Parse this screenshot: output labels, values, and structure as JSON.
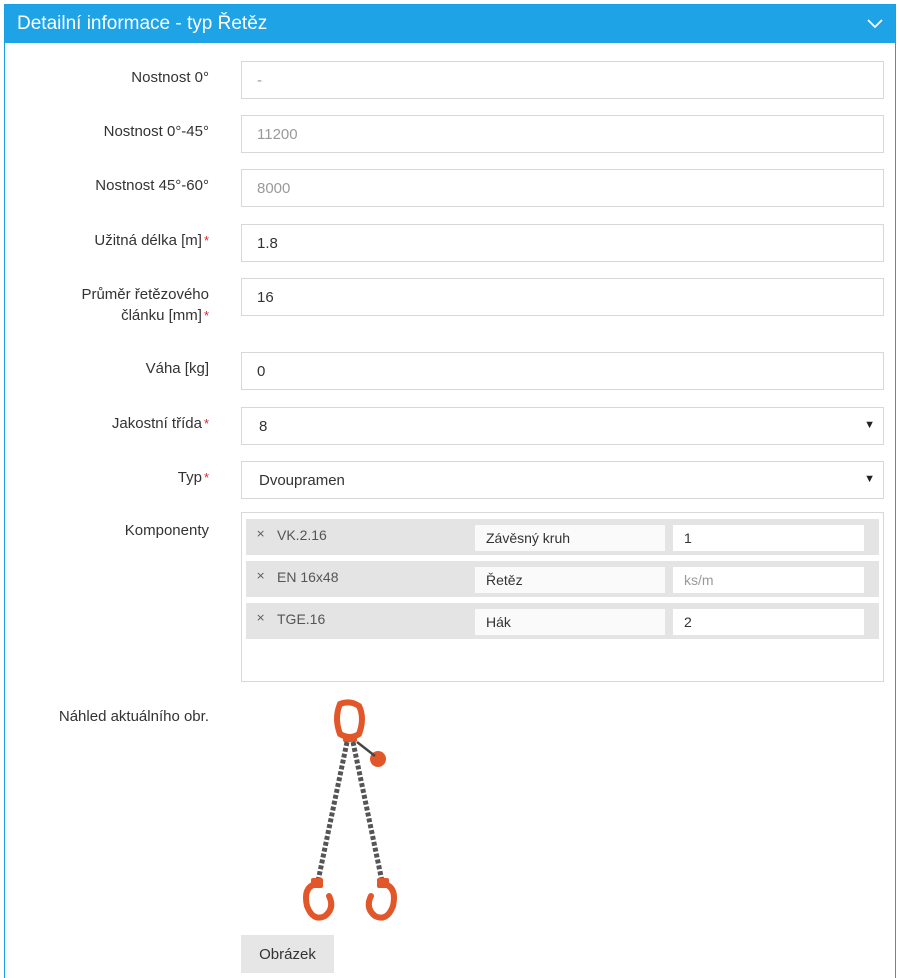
{
  "header": {
    "title": "Detailní informace - typ Řetěz"
  },
  "icons": {
    "collapse": "chevron-down-icon",
    "remove": "close-icon",
    "select": "caret-down-icon"
  },
  "colors": {
    "accent": "#1ea3e6",
    "required": "#d9262b"
  },
  "form": {
    "nostnost0": {
      "label": "Nostnost 0°",
      "value": "-"
    },
    "nostnost045": {
      "label": "Nostnost 0°-45°",
      "value": "11200"
    },
    "nostnost4560": {
      "label": "Nostnost 45°-60°",
      "value": "8000"
    },
    "uzitna_delka": {
      "label": "Užitná délka [m]",
      "value": "1.8",
      "required": "*"
    },
    "prumer": {
      "label_line1": "Průměr řetězového",
      "label_line2": "článku [mm]",
      "value": "16",
      "required": "*"
    },
    "vaha": {
      "label": "Váha [kg]",
      "value": "0"
    },
    "jakostni_trida": {
      "label": "Jakostní třída",
      "value": "8",
      "required": "*"
    },
    "typ": {
      "label": "Typ",
      "value": "Dvoupramen",
      "required": "*"
    }
  },
  "komponenty": {
    "label": "Komponenty",
    "items": [
      {
        "remove": "×",
        "code": "VK.2.16",
        "name": "Závěsný kruh",
        "qty": "1"
      },
      {
        "remove": "×",
        "code": "EN 16x48",
        "name": "Řetěz",
        "qty_placeholder": "ks/m"
      },
      {
        "remove": "×",
        "code": "TGE.16",
        "name": "Hák",
        "qty": "2"
      }
    ]
  },
  "preview": {
    "label": "Náhled aktuálního obr."
  },
  "button": {
    "label": "Obrázek"
  }
}
